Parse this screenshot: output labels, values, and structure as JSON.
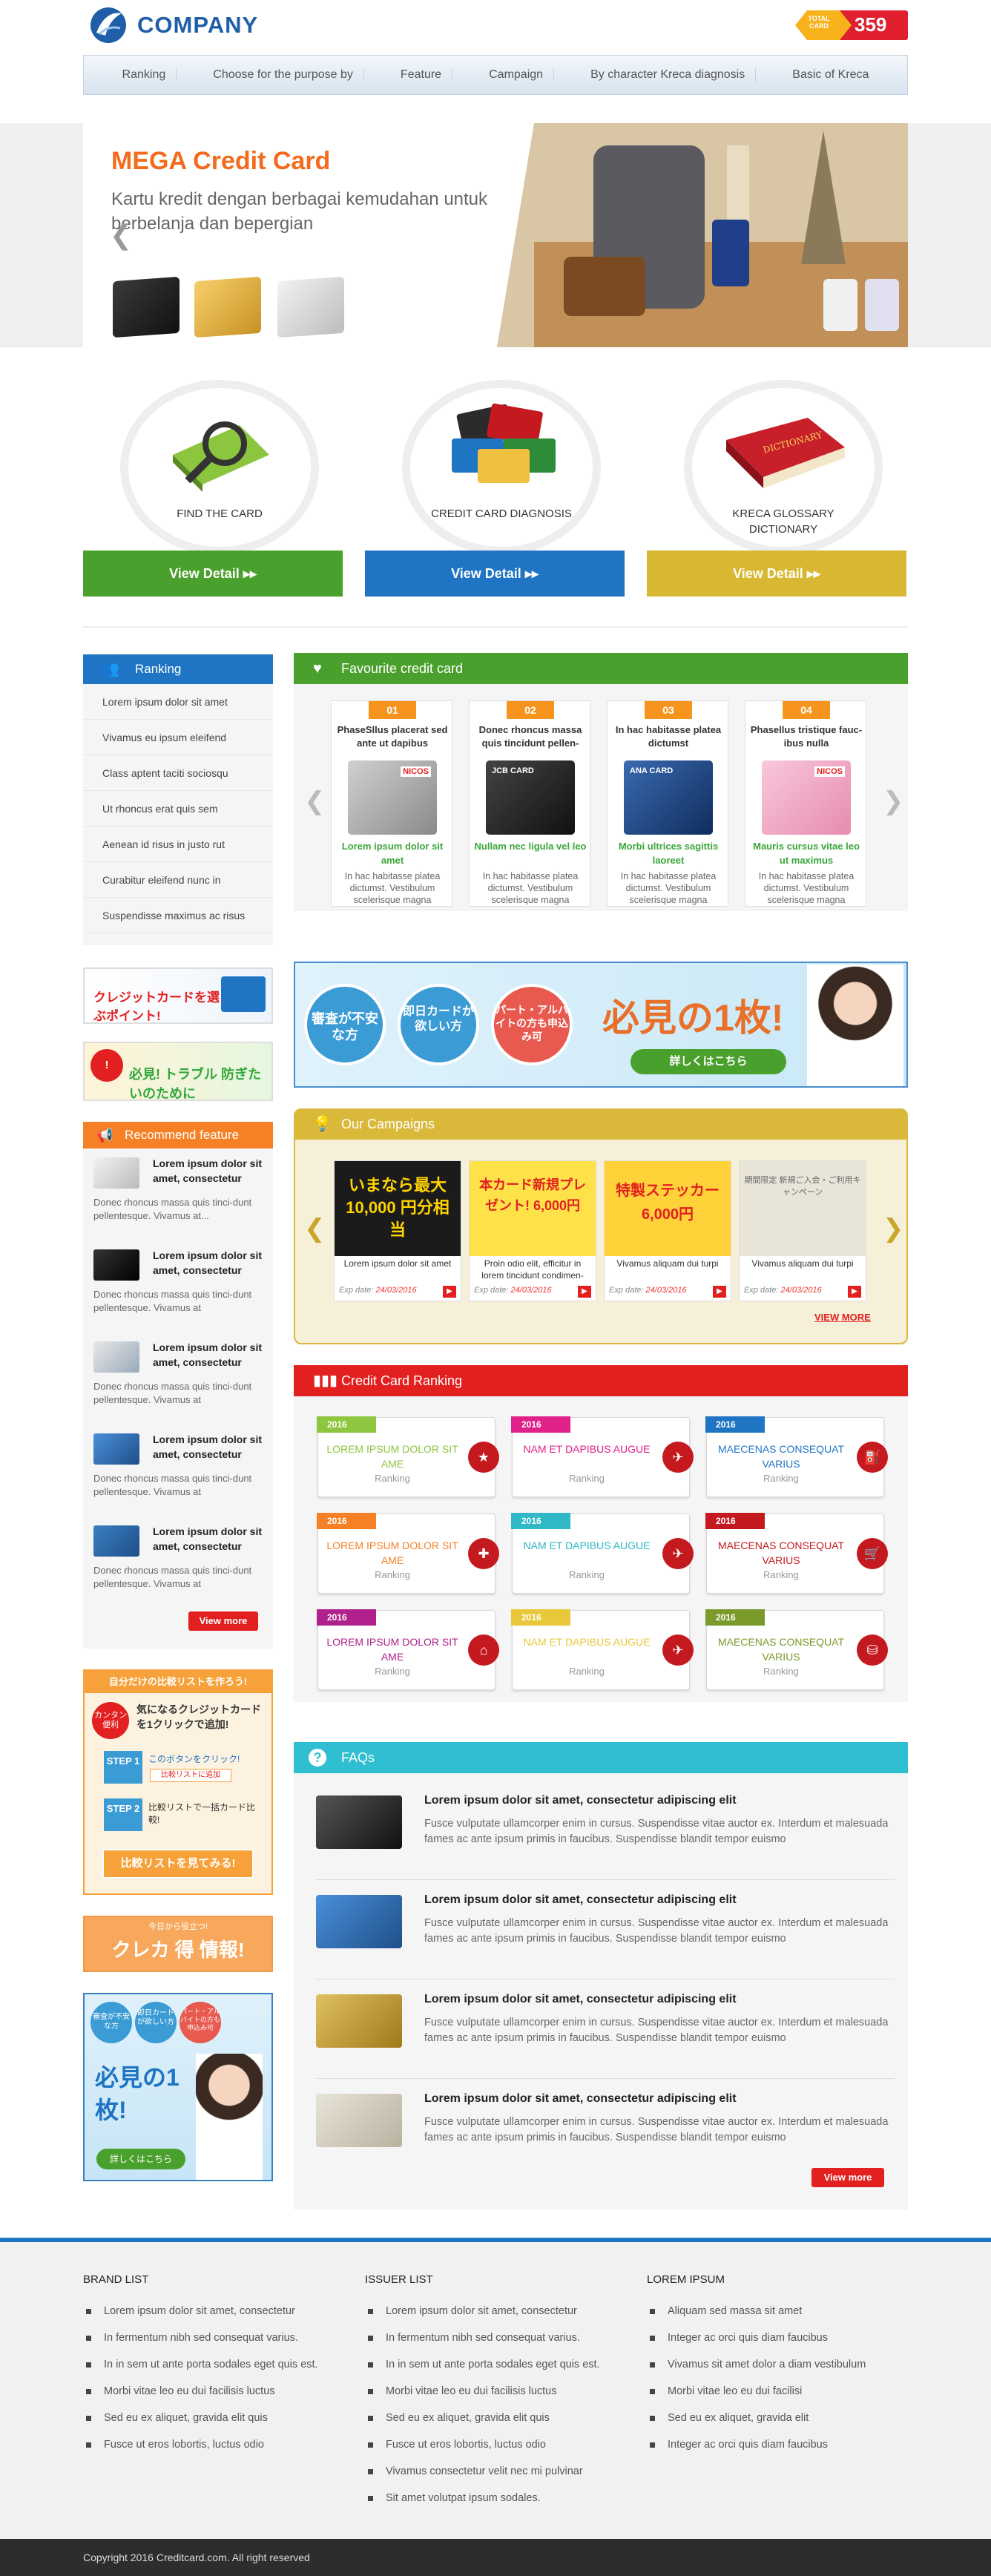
{
  "header": {
    "logo_text": "COMPANY",
    "total_label": "TOTAL CARD",
    "total_count": "359"
  },
  "nav": [
    "Ranking",
    "Choose for the purpose by",
    "Feature",
    "Campaign",
    "By character Kreca diagnosis",
    "Basic of Kreca"
  ],
  "banner": {
    "title": "MEGA Credit Card",
    "subtitle": "Kartu kredit dengan berbagai kemudahan untuk berbelanja dan bepergian",
    "prev_arrow": "❮"
  },
  "tools": [
    {
      "label": "FIND THE CARD",
      "button": "View Detail",
      "color": "#4aa02c"
    },
    {
      "label": "CREDIT CARD DIAGNOSIS",
      "button": "View Detail",
      "color": "#1f75c4"
    },
    {
      "label": "KRECA GLOSSARY DICTIONARY",
      "button": "View Detail",
      "color": "#d8b732"
    }
  ],
  "sidebar": {
    "ranking_title": "Ranking",
    "ranking_items": [
      "Lorem ipsum dolor sit amet",
      "Vivamus eu ipsum eleifend",
      "Class aptent taciti sociosqu",
      "Ut rhoncus erat quis sem",
      "Aenean id risus in justo rut",
      "Curabitur eleifend nunc in",
      "Suspendisse maximus ac risus"
    ],
    "ad1_text": "クレジットカードを選ぶポイント!",
    "ad2_text": "必見! トラブル 防ぎたいのために",
    "recommend_title": "Recommend feature",
    "recommend_items": [
      {
        "title": "Lorem ipsum dolor sit amet, consectetur",
        "desc": "Donec rhoncus massa quis tinci-dunt pellentesque. Vivamus at..."
      },
      {
        "title": "Lorem ipsum dolor sit amet, consectetur",
        "desc": "Donec rhoncus massa quis tinci-dunt pellentesque. Vivamus at"
      },
      {
        "title": "Lorem ipsum dolor sit amet, consectetur",
        "desc": "Donec rhoncus massa quis tinci-dunt pellentesque. Vivamus at"
      },
      {
        "title": "Lorem ipsum dolor sit amet, consectetur",
        "desc": "Donec rhoncus massa quis tinci-dunt pellentesque. Vivamus at"
      },
      {
        "title": "Lorem ipsum dolor sit amet, consectetur",
        "desc": "Donec rhoncus massa quis tinci-dunt pellentesque. Vivamus at"
      }
    ],
    "view_more": "View more",
    "compare_title": "自分だけの比較リストを作ろう!",
    "compare_easy": "カンタン便利",
    "compare_text": "気になるクレジットカードを1クリックで追加!",
    "step1": "STEP 1",
    "step1_text": "このボタンをクリック!",
    "step1_sub": "比較リストに追加",
    "step2": "STEP 2",
    "step2_text": "比較リストで一括カード比較!",
    "compare_button": "比較リストを見てみる!",
    "kureka_small": "今日から役立つ!",
    "kureka_text": "クレカ 得 情報!",
    "ad3_circle1": "審査が不安な方",
    "ad3_circle2": "即日カードが欲しい方",
    "ad3_circle3": "パート・アルバイトの方も申込み可",
    "ad3_text": "必見の1枚!",
    "ad3_button": "詳しくはこちら"
  },
  "favourite": {
    "title": "Favourite credit card",
    "cards": [
      {
        "num": "01",
        "title": "PhaseSllus placerat sed ante ut dapibus",
        "green": "Lorem ipsum dolor sit amet",
        "desc": "In hac habitasse platea dictumst. Vestibulum scelerisque magna",
        "color": "#b5b5b5",
        "card_text": "NICOS"
      },
      {
        "num": "02",
        "title": "Donec rhoncus massa quis tincidunt pellen-",
        "green": "Nullam nec ligula vel leo",
        "desc": "In hac habitasse platea dictumst. Vestibulum scelerisque magna",
        "color": "#2b2b2b",
        "card_text": "JCB CARD"
      },
      {
        "num": "03",
        "title": "In hac habitasse platea dictumst",
        "green": "Morbi ultrices sagittis laoreet",
        "desc": "In hac habitasse platea dictumst. Vestibulum scelerisque magna",
        "color": "#1f3f7a",
        "card_text": "ANA CARD"
      },
      {
        "num": "04",
        "title": "Phasellus tristique fauc-ibus nulla",
        "green": "Mauris cursus vitae leo ut maximus",
        "desc": "In hac habitasse platea dictumst. Vestibulum scelerisque magna",
        "color": "#f0a9c6",
        "card_text": "NICOS"
      }
    ]
  },
  "mid_ad": {
    "circle1": "審査が不安な方",
    "circle2": "即日カードが欲しい方",
    "circle3": "パート・アルバイトの方も申込み可",
    "headline": "必見の1枚!",
    "button": "詳しくはこちら"
  },
  "campaigns": {
    "title": "Our Campaigns",
    "items": [
      {
        "title": "Lorem ipsum dolor sit amet",
        "exp_label": "Exp date:",
        "exp": "24/03/2016",
        "img_text": "いまなら最大 10,000 円分相当",
        "bg": "#1b1b1b",
        "fg": "#ffd400"
      },
      {
        "title": "Proin odio elit, efficitur in lorem tincidunt condimen-",
        "exp_label": "Exp date:",
        "exp": "24/03/2016",
        "img_text": "本カード新規プレゼント! 6,000円",
        "bg": "#ffe14a",
        "fg": "#e32020"
      },
      {
        "title": "Vivamus aliquam dui turpi",
        "exp_label": "Exp date:",
        "exp": "24/03/2016",
        "img_text": "特製ステッカー 6,000円",
        "bg": "#ffd23a",
        "fg": "#e32020"
      },
      {
        "title": "Vivamus aliquam dui turpi",
        "exp_label": "Exp date:",
        "exp": "24/03/2016",
        "img_text": "期間限定 新規ご入会・ご利用キャンペーン",
        "bg": "#e9e4d8",
        "fg": "#666"
      }
    ],
    "view_more": "VIEW MORE"
  },
  "ranking_section": {
    "title": "Credit Card Ranking",
    "items": [
      {
        "year": "2016",
        "name": "LOREM IPSUM DOLOR SIT AME",
        "sub": "Ranking",
        "color": "#8dc63f",
        "icon": "★"
      },
      {
        "year": "2016",
        "name": "NAM ET DAPIBUS AUGUE",
        "sub": "Ranking",
        "color": "#e0218a",
        "icon": "✈"
      },
      {
        "year": "2016",
        "name": "MAECENAS CONSEQUAT VARIUS",
        "sub": "Ranking",
        "color": "#1f75c4",
        "icon": "⛽"
      },
      {
        "year": "2016",
        "name": "LOREM IPSUM DOLOR SIT AME",
        "sub": "Ranking",
        "color": "#f58025",
        "icon": "✚"
      },
      {
        "year": "2016",
        "name": "NAM ET DAPIBUS AUGUE",
        "sub": "Ranking",
        "color": "#2fb8c5",
        "icon": "✈"
      },
      {
        "year": "2016",
        "name": "MAECENAS CONSEQUAT VARIUS",
        "sub": "Ranking",
        "color": "#c41a1f",
        "icon": "🛒"
      },
      {
        "year": "2016",
        "name": "LOREM IPSUM DOLOR SIT AME",
        "sub": "Ranking",
        "color": "#b0218c",
        "icon": "⌂"
      },
      {
        "year": "2016",
        "name": "NAM ET DAPIBUS AUGUE",
        "sub": "Ranking",
        "color": "#e8c83a",
        "icon": "✈"
      },
      {
        "year": "2016",
        "name": "MAECENAS CONSEQUAT VARIUS",
        "sub": "Ranking",
        "color": "#7a9a2a",
        "icon": "⛁"
      }
    ]
  },
  "faqs": {
    "title": "FAQs",
    "items": [
      {
        "title": "Lorem ipsum dolor sit amet, consectetur adipiscing elit",
        "desc": "Fusce vulputate ullamcorper enim in cursus. Suspendisse vitae auctor ex. Interdum et malesuada fames ac ante ipsum primis in faucibus. Suspendisse blandit tempor euismo",
        "color": "#333"
      },
      {
        "title": "Lorem ipsum dolor sit amet, consectetur adipiscing elit",
        "desc": "Fusce vulputate ullamcorper enim in cursus. Suspendisse vitae auctor ex. Interdum et malesuada fames ac ante ipsum primis in faucibus. Suspendisse blandit tempor euismo",
        "color": "#1f6fc4"
      },
      {
        "title": "Lorem ipsum dolor sit amet, consectetur adipiscing elit",
        "desc": "Fusce vulputate ullamcorper enim in cursus. Suspendisse vitae auctor ex. Interdum et malesuada fames ac ante ipsum primis in faucibus. Suspendisse blandit tempor euismo",
        "color": "#c99a2a"
      },
      {
        "title": "Lorem ipsum dolor sit amet, consectetur adipiscing elit",
        "desc": "Fusce vulputate ullamcorper enim in cursus. Suspendisse vitae auctor ex. Interdum et malesuada fames ac ante ipsum primis in faucibus. Suspendisse blandit tempor euismo",
        "color": "#c8c2b0"
      }
    ],
    "view_more": "View more"
  },
  "footer": {
    "col1_title": "BRAND LIST",
    "col1": [
      "Lorem ipsum dolor sit amet, consectetur",
      "In fermentum nibh sed consequat varius.",
      "In in sem ut ante porta sodales eget quis est.",
      "Morbi vitae leo eu dui facilisis luctus",
      "Sed eu ex aliquet, gravida elit quis",
      "Fusce ut eros lobortis, luctus odio"
    ],
    "col2_title": "ISSUER LIST",
    "col2": [
      "Lorem ipsum dolor sit amet, consectetur",
      "In fermentum nibh sed consequat varius.",
      "In in sem ut ante porta sodales eget quis est.",
      "Morbi vitae leo eu dui facilisis luctus",
      "Sed eu ex aliquet, gravida elit quis",
      "Fusce ut eros lobortis, luctus odio",
      "Vivamus consectetur velit nec mi pulvinar",
      "Sit amet volutpat ipsum sodales."
    ],
    "col3_title": "LOREM IPSUM",
    "col3": [
      "Aliquam sed massa sit amet",
      "Integer ac orci quis diam faucibus",
      "Vivamus sit amet dolor a diam vestibulum",
      "Morbi vitae leo eu dui facilisi",
      "Sed eu ex aliquet, gravida elit",
      "Integer ac orci quis diam faucibus"
    ],
    "copyright": "Copyright 2016 Creditcard.com. All right reserved"
  }
}
